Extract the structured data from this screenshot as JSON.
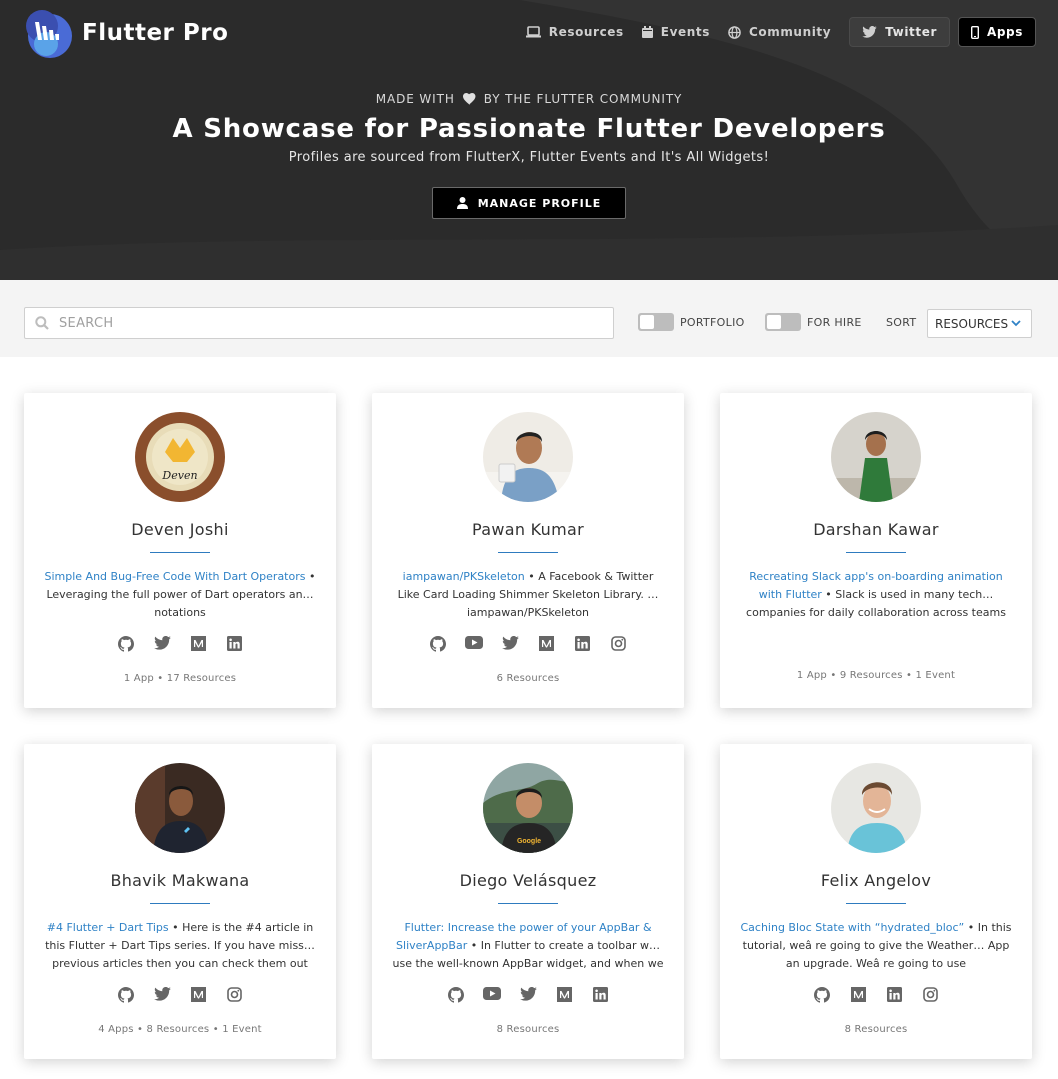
{
  "header": {
    "brand_name": "Flutter Pro",
    "nav": [
      {
        "label": "Resources",
        "icon": "laptop-icon"
      },
      {
        "label": "Events",
        "icon": "calendar-icon"
      },
      {
        "label": "Community",
        "icon": "globe-icon"
      }
    ],
    "twitter_label": "Twitter",
    "apps_label": "Apps"
  },
  "hero": {
    "tagline_pre": "MADE WITH",
    "tagline_post": "BY THE FLUTTER COMMUNITY",
    "title": "A Showcase for Passionate Flutter Developers",
    "subtitle": "Profiles are sourced from FlutterX, Flutter Events and It's All Widgets!",
    "manage_label": "MANAGE PROFILE"
  },
  "filters": {
    "search_placeholder": "SEARCH",
    "portfolio_label": "PORTFOLIO",
    "for_hire_label": "FOR HIRE",
    "sort_label": "SORT",
    "sort_value": "RESOURCES"
  },
  "colors": {
    "hero_bg": "#2b2b2b",
    "link": "#2f82c6",
    "divider": "#2e7bbf",
    "icon": "#666666"
  },
  "profiles": [
    {
      "name": "Deven Joshi",
      "link_text": "Simple And Bug-Free Code With Dart Operators",
      "rest_text": " • Leveraging the full power of Dart operators an… notations",
      "socials": [
        "github-icon",
        "twitter-icon",
        "medium-icon",
        "linkedin-icon"
      ],
      "stats": "1 App • 17 Resources"
    },
    {
      "name": "Pawan Kumar",
      "link_text": "iampawan/PKSkeleton",
      "rest_text": " • A Facebook & Twitter Like Card Loading Shimmer Skeleton Library. … iampawan/PKSkeleton",
      "socials": [
        "github-icon",
        "youtube-icon",
        "twitter-icon",
        "medium-icon",
        "linkedin-icon",
        "instagram-icon"
      ],
      "stats": "6 Resources"
    },
    {
      "name": "Darshan Kawar",
      "link_text": "Recreating Slack app's on-boarding animation with Flutter",
      "rest_text": " • Slack is used in many tech… companies for daily collaboration across teams",
      "socials": [],
      "stats": "1 App • 9 Resources • 1 Event"
    },
    {
      "name": "Bhavik Makwana",
      "link_text": "#4 Flutter + Dart Tips",
      "rest_text": " • Here is the #4 article in this Flutter + Dart Tips series. If you have miss… previous articles then you can check them out",
      "socials": [
        "github-icon",
        "twitter-icon",
        "medium-icon",
        "instagram-icon"
      ],
      "stats": "4 Apps • 8 Resources • 1 Event"
    },
    {
      "name": "Diego Velásquez",
      "link_text": "Flutter: Increase the power of your AppBar & SliverAppBar",
      "rest_text": " • In Flutter to create a toolbar w… use the well-known AppBar widget, and when we",
      "socials": [
        "github-icon",
        "youtube-icon",
        "twitter-icon",
        "medium-icon",
        "linkedin-icon"
      ],
      "stats": "8 Resources"
    },
    {
      "name": "Felix Angelov",
      "link_text": "Caching Bloc State with “hydrated_bloc”",
      "rest_text": " • In this tutorial, weâ re going to give the Weather… App an upgrade. Weâ re going to use",
      "socials": [
        "github-icon",
        "medium-icon",
        "linkedin-icon",
        "instagram-icon"
      ],
      "stats": "8 Resources"
    }
  ]
}
